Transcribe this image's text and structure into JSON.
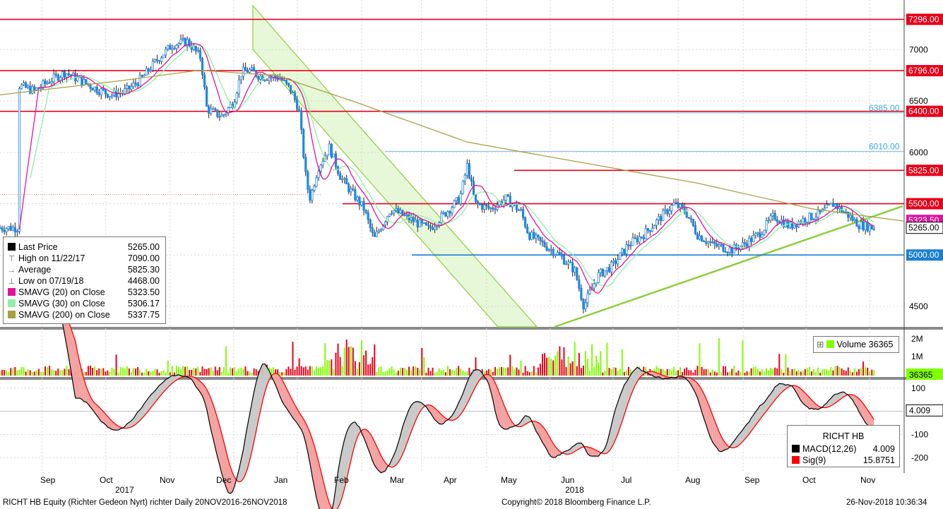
{
  "chart_data": {
    "type": "candlestick",
    "instrument": "RICHT HB Equity (Richter Gedeon Nyrt) richter",
    "period": "Daily 20NOV2016-26NOV2018",
    "price_axis": {
      "ylim": [
        4300,
        7450
      ],
      "ticks": [
        4500,
        5000,
        5500,
        6000,
        6500,
        7000
      ]
    },
    "price_weekly": [
      [
        2016.715,
        6650
      ],
      [
        2016.735,
        6600
      ],
      [
        2016.755,
        6700
      ],
      [
        2016.775,
        6780
      ],
      [
        2016.795,
        6700
      ],
      [
        2016.815,
        6620
      ],
      [
        2016.835,
        6560
      ],
      [
        2016.855,
        6600
      ],
      [
        2016.875,
        6720
      ],
      [
        2016.895,
        6900
      ],
      [
        2016.915,
        7050
      ],
      [
        2016.935,
        7080
      ],
      [
        2016.952,
        6920
      ],
      [
        2016.96,
        6420
      ],
      [
        2016.98,
        6350
      ],
      [
        2016.995,
        6500
      ],
      [
        2017.005,
        6780
      ],
      [
        2017.015,
        6800
      ],
      [
        2017.03,
        6740
      ],
      [
        2017.055,
        6730
      ],
      [
        2017.07,
        6600
      ],
      [
        2017.08,
        6420
      ],
      [
        2017.09,
        5700
      ],
      [
        2017.095,
        5550
      ],
      [
        2017.105,
        5850
      ],
      [
        2017.12,
        6050
      ],
      [
        2017.135,
        5750
      ],
      [
        2017.15,
        5600
      ],
      [
        2017.165,
        5450
      ],
      [
        2017.178,
        5150
      ],
      [
        2017.2,
        5450
      ],
      [
        2017.225,
        5350
      ],
      [
        2017.25,
        5250
      ],
      [
        2017.27,
        5400
      ],
      [
        2017.29,
        5550
      ],
      [
        2017.3,
        5880
      ],
      [
        2017.31,
        5500
      ],
      [
        2017.33,
        5450
      ],
      [
        2017.35,
        5550
      ],
      [
        2017.37,
        5420
      ],
      [
        2017.38,
        5200
      ],
      [
        2017.4,
        5100
      ],
      [
        2017.42,
        5000
      ],
      [
        2017.44,
        4850
      ],
      [
        2017.452,
        4500
      ],
      [
        2017.47,
        4800
      ],
      [
        2017.49,
        4900
      ],
      [
        2017.51,
        5100
      ],
      [
        2017.53,
        5200
      ],
      [
        2017.55,
        5350
      ],
      [
        2017.57,
        5500
      ],
      [
        2017.585,
        5420
      ],
      [
        2017.6,
        5200
      ],
      [
        2017.62,
        5100
      ],
      [
        2017.645,
        5050
      ],
      [
        2017.66,
        5100
      ],
      [
        2017.68,
        5200
      ],
      [
        2017.7,
        5380
      ],
      [
        2017.72,
        5280
      ],
      [
        2017.74,
        5350
      ],
      [
        2017.76,
        5400
      ],
      [
        2017.778,
        5500
      ],
      [
        2017.795,
        5400
      ],
      [
        2017.81,
        5300
      ],
      [
        2017.83,
        5265
      ]
    ],
    "series": [
      {
        "name": "SMAVG (20)  on Close",
        "color": "#e0149a"
      },
      {
        "name": "SMAVG (30)  on Close",
        "color": "#8ff0a4"
      },
      {
        "name": "SMAVG (200)  on Close",
        "color": "#a8a040"
      }
    ],
    "horizontal_levels": [
      {
        "value": 7296.0,
        "label": "7296.00",
        "color": "#e8001a"
      },
      {
        "value": 6796.0,
        "label": "6796.00",
        "color": "#e8001a"
      },
      {
        "value": 6400.0,
        "label": "6400.00",
        "color": "#e8001a"
      },
      {
        "value": 5825.0,
        "label": "5825.00",
        "color": "#e8001a"
      },
      {
        "value": 5500.0,
        "label": "5500.00",
        "color": "#e8001a"
      },
      {
        "value": 5000.0,
        "label": "5000.00",
        "color": "#1a7fd4"
      }
    ],
    "fib_levels": [
      {
        "value": 6385.0,
        "label": "6385.00"
      },
      {
        "value": 6010.0,
        "label": "6010.00"
      }
    ],
    "price_tags": [
      {
        "value": 5323.5,
        "label": "5323.50",
        "color": "#e0149a"
      },
      {
        "value": 5265.0,
        "label": "5265.00",
        "color": "#ffffff"
      }
    ],
    "volume_axis": {
      "ticks": [
        "2M",
        "1M"
      ]
    },
    "volume_tag": "36365",
    "macd_axis": {
      "ylim": [
        -260,
        130
      ],
      "ticks": [
        100,
        -100,
        -200
      ]
    },
    "macd_tag": "4.009",
    "x_axis": {
      "months": [
        "Sep",
        "Oct",
        "Nov",
        "Dec",
        "Jan",
        "Feb",
        "Mar",
        "Apr",
        "May",
        "Jun",
        "Jul",
        "Aug",
        "Sep",
        "Oct",
        "Nov"
      ],
      "years": [
        "2017",
        "2018"
      ]
    }
  },
  "legend": {
    "rows": [
      {
        "label": "Last Price",
        "value": "5265.00",
        "icon": "black-square",
        "color": "#000000"
      },
      {
        "label": "High on 11/22/17",
        "value": "7090.00",
        "icon": "high-marker"
      },
      {
        "label": "Average",
        "value": "5825.30",
        "icon": "average-marker"
      },
      {
        "label": "Low on 07/19/18",
        "value": "4468.00",
        "icon": "low-marker"
      },
      {
        "label": "SMAVG (20)  on Close",
        "value": "5323.50",
        "icon": "square",
        "color": "#e0149a"
      },
      {
        "label": "SMAVG (30)  on Close",
        "value": "5306.17",
        "icon": "square",
        "color": "#8ff0a4"
      },
      {
        "label": "SMAVG (200)  on Close",
        "value": "5337.75",
        "icon": "square",
        "color": "#a8a040"
      }
    ]
  },
  "volume_legend": {
    "label": "Volume",
    "value": "36365"
  },
  "macd_legend": {
    "title": "RICHT HB",
    "rows": [
      {
        "label": "MACD(12,26)",
        "value": "4.009",
        "color": "#000000"
      },
      {
        "label": "Sig(9)",
        "value": "15.8751",
        "color": "#ff0000"
      }
    ]
  },
  "footer": {
    "left": "RICHT HB Equity (Richter Gedeon Nyrt) richter  Daily 20NOV2016-26NOV2018",
    "center": "Copyright© 2018 Bloomberg Finance L.P.",
    "right": "26-Nov-2018 10:36:34"
  }
}
